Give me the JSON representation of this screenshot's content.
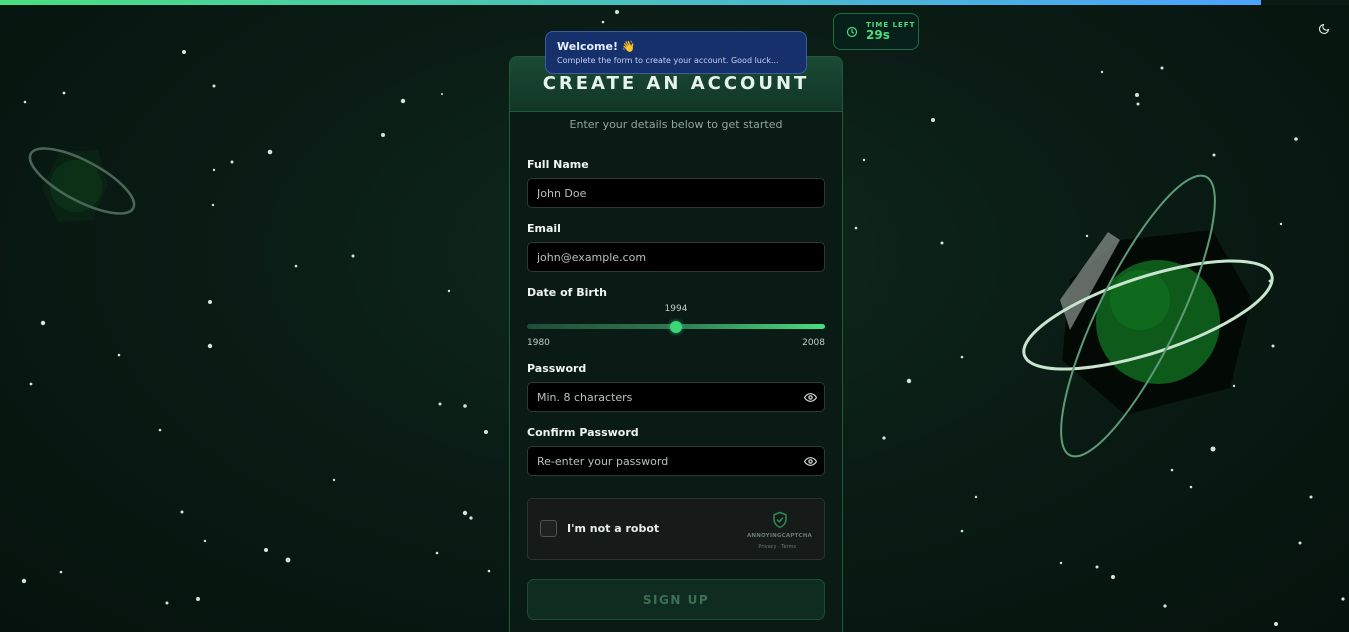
{
  "progress": {
    "fraction": 0.935
  },
  "theme_toggle": {
    "icon": "moon-icon"
  },
  "timer": {
    "label": "TIME LEFT",
    "value": "29s",
    "icon": "clock-icon"
  },
  "toast": {
    "title": "Welcome! 👋",
    "message": "Complete the form to create your account. Good luck..."
  },
  "form": {
    "title": "CREATE AN ACCOUNT",
    "subtitle": "Enter your details below to get started",
    "full_name": {
      "label": "Full Name",
      "placeholder": "John Doe"
    },
    "email": {
      "label": "Email",
      "placeholder": "john@example.com"
    },
    "dob": {
      "label": "Date of Birth",
      "value": "1994",
      "min": "1980",
      "max": "2008"
    },
    "password": {
      "label": "Password",
      "placeholder": "Min. 8 characters",
      "icon": "eye-icon"
    },
    "confirm_password": {
      "label": "Confirm Password",
      "placeholder": "Re-enter your password",
      "icon": "eye-icon"
    },
    "captcha": {
      "label": "I'm not a robot",
      "brand": "ANNOYINGCAPTCHA",
      "links": "Privacy · Terms",
      "icon": "shield-check-icon"
    },
    "submit_label": "SIGN UP"
  },
  "colors": {
    "accent": "#4ade80",
    "progress_end": "#4aa3ff",
    "toast_bg": "#15306b",
    "card_bg": "#0a1a14"
  }
}
